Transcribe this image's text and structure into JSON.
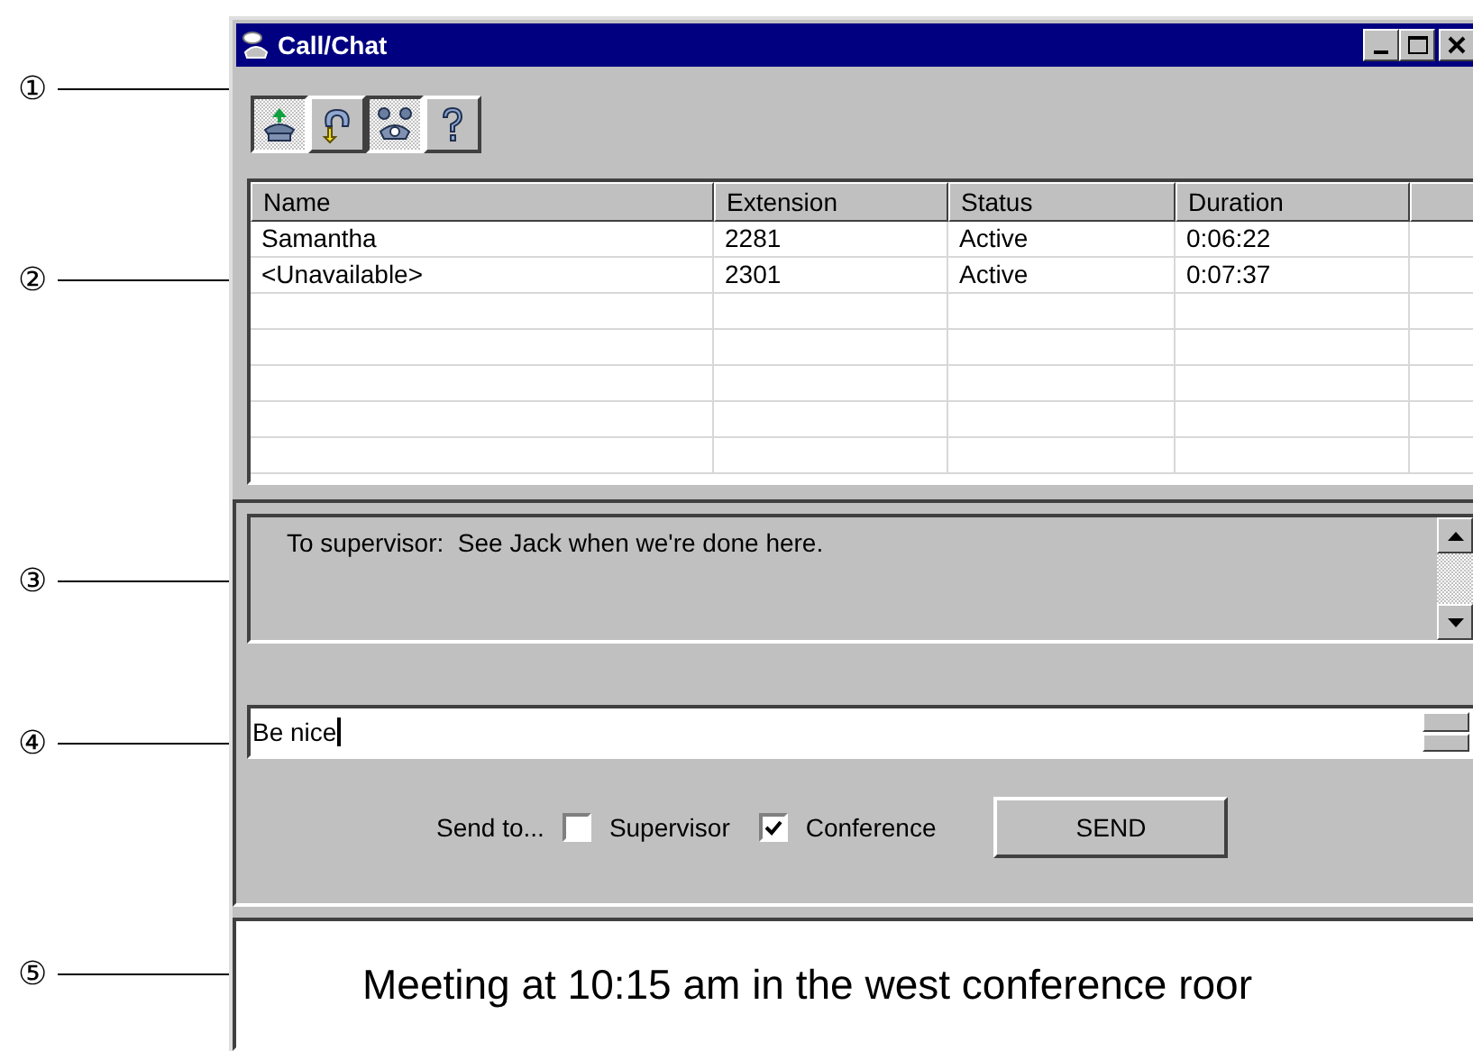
{
  "callouts": [
    "①",
    "②",
    "③",
    "④",
    "⑤"
  ],
  "window": {
    "title": "Call/Chat"
  },
  "toolbar": {
    "buttons": [
      {
        "kind": "phone-up",
        "pressed": true
      },
      {
        "kind": "transfer",
        "pressed": false
      },
      {
        "kind": "conference",
        "pressed": true
      },
      {
        "kind": "help",
        "pressed": false
      }
    ]
  },
  "table": {
    "columns": [
      "Name",
      "Extension",
      "Status",
      "Duration"
    ],
    "rows": [
      [
        "Samantha",
        "2281",
        "Active",
        "0:06:22"
      ],
      [
        "<Unavailable>",
        "2301",
        "Active",
        "0:07:37"
      ]
    ]
  },
  "chat": {
    "messages": [
      "To supervisor:  See Jack when we're done here."
    ]
  },
  "input": {
    "value": "Be nice"
  },
  "send": {
    "label": "Send to...",
    "recipients": [
      {
        "label": "Supervisor",
        "checked": false
      },
      {
        "label": "Conference",
        "checked": true
      }
    ],
    "button": "SEND"
  },
  "banner": {
    "text": "Meeting at 10:15 am in the west conference roor"
  }
}
